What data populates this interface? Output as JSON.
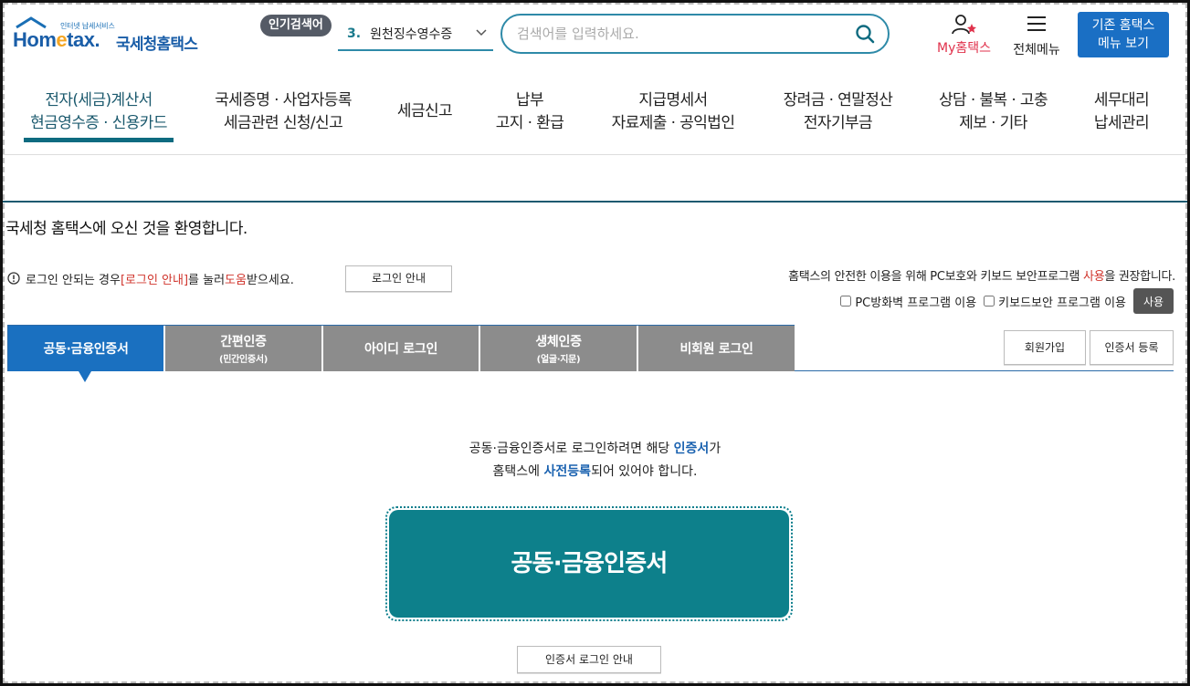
{
  "header": {
    "logo_small_text": "인터넷 납세서비스",
    "logo_word_pre": "Hom",
    "logo_word_e": "e",
    "logo_word_post": "tax.",
    "logo_korean": "국세청홈택스",
    "popular_badge": "인기검색어",
    "popular_rank": "3.",
    "popular_term": "원천징수영수증",
    "search_placeholder": "검색어를 입력하세요.",
    "my_home_label": "My홈택스",
    "all_menu_label": "전체메뉴",
    "old_home_line1": "기존 홈택스",
    "old_home_line2": "메뉴 보기"
  },
  "gnb": {
    "items": [
      {
        "line1": "전자(세금)계산서",
        "line2": "현금영수증 · 신용카드"
      },
      {
        "line1": "국세증명 · 사업자등록",
        "line2": "세금관련 신청/신고"
      },
      {
        "line1": "세금신고",
        "line2": ""
      },
      {
        "line1": "납부",
        "line2": "고지 · 환급"
      },
      {
        "line1": "지급명세서",
        "line2": "자료제출 · 공익법인"
      },
      {
        "line1": "장려금 · 연말정산",
        "line2": "전자기부금"
      },
      {
        "line1": "상담 · 불복 · 고충",
        "line2": "제보 · 기타"
      },
      {
        "line1": "세무대리",
        "line2": "납세관리"
      }
    ]
  },
  "welcome": "국세청 홈택스에 오신 것을 환영합니다.",
  "help": {
    "text1": "로그인 안되는 경우 ",
    "link": "[로그인 안내]",
    "text2": "를 눌러 ",
    "red2": "도움",
    "text3": "받으세요.",
    "button": "로그인 안내"
  },
  "security": {
    "note1": "홈택스의 안전한 이용을 위해 PC보호와 키보드 보안프로그램 ",
    "note_red": "사용",
    "note2": "을 권장합니다.",
    "opt_firewall": "PC방화벽 프로그램 이용",
    "opt_keyboard": "키보드보안 프로그램 이용",
    "use_button": "사용"
  },
  "tabs": [
    {
      "label": "공동·금융인증서",
      "sub": ""
    },
    {
      "label": "간편인증",
      "sub": "(민간인증서)"
    },
    {
      "label": "아이디 로그인",
      "sub": ""
    },
    {
      "label": "생체인증",
      "sub": "(얼굴·지문)"
    },
    {
      "label": "비회원 로그인",
      "sub": ""
    }
  ],
  "side_buttons": {
    "join": "회원가입",
    "cert_register": "인증서 등록"
  },
  "description": {
    "l1_a": "공동·금융인증서로 로그인하려면 해당 ",
    "l1_hl": "인증서",
    "l1_b": "가",
    "l2_a": "홈택스에 ",
    "l2_hl": "사전등록",
    "l2_b": "되어 있어야 합니다."
  },
  "cert_button": "공동·금융인증서",
  "cert_guide_button": "인증서 로그인 안내",
  "colors": {
    "primary_teal": "#0d808b",
    "tab_active": "#1a70c0",
    "tab_inactive": "#8c8c8c",
    "accent_red": "#d0342c",
    "brand_blue": "#1a5ea8"
  }
}
